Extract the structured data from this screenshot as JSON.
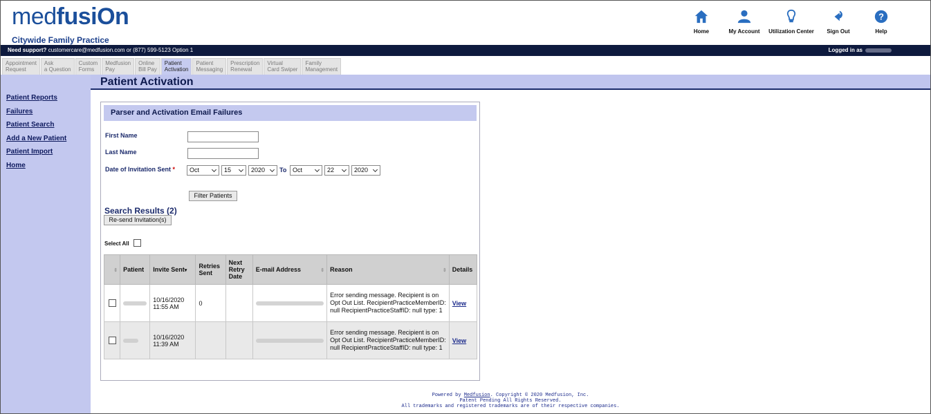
{
  "brand": {
    "logo_light": "med",
    "logo_bold": "fusiOn",
    "practice": "Citywide Family Practice"
  },
  "topnav": [
    {
      "label": "Home",
      "icon": "home-icon"
    },
    {
      "label": "My Account",
      "icon": "user-icon"
    },
    {
      "label": "Utilization Center",
      "icon": "bulb-icon"
    },
    {
      "label": "Sign Out",
      "icon": "signout-icon"
    },
    {
      "label": "Help",
      "icon": "help-icon"
    }
  ],
  "support": {
    "label": "Need support?",
    "text": "customercare@medfusion.com or (877) 599-5123 Option 1",
    "logged_in": "Logged in as"
  },
  "tabs": [
    [
      "Appointment",
      "Request"
    ],
    [
      "Ask",
      "a Question"
    ],
    [
      "Custom",
      "Forms"
    ],
    [
      "Medfusion",
      "Pay"
    ],
    [
      "Online",
      "Bill Pay"
    ],
    [
      "Patient",
      "Activation"
    ],
    [
      "Patient",
      "Messaging"
    ],
    [
      "Prescription",
      "Renewal"
    ],
    [
      "Virtual",
      "Card Swiper"
    ],
    [
      "Family",
      "Management"
    ]
  ],
  "page_title": "Patient Activation",
  "sidebar": [
    "Patient Reports",
    "Failures",
    "Patient Search",
    "Add a New Patient",
    "Patient Import",
    "Home"
  ],
  "panel": {
    "title": "Parser and Activation Email Failures",
    "first_name_label": "First Name",
    "last_name_label": "Last Name",
    "date_label": "Date of Invitation Sent",
    "required_mark": "*",
    "to_label": "To",
    "from_month": "Oct",
    "from_day": "15",
    "from_year": "2020",
    "to_month": "Oct",
    "to_day": "22",
    "to_year": "2020",
    "filter_button": "Filter Patients",
    "results_title": "Search Results (2)",
    "resend_button": "Re-send Invitation(s)",
    "select_all": "Select All"
  },
  "table": {
    "headers": [
      "Patient",
      "Invite Sent",
      "Retries Sent",
      "Next Retry Date",
      "E-mail Address",
      "Reason",
      "Details"
    ],
    "rows": [
      {
        "sent_date": "10/16/2020",
        "sent_time": "11:55 AM",
        "retries": "0",
        "reason": "Error sending message. Recipient is on Opt Out List. RecipientPracticeMemberID: null RecipientPracticeStaffID: null type: 1",
        "details": "View"
      },
      {
        "sent_date": "10/16/2020",
        "sent_time": "11:39 AM",
        "retries": "",
        "reason": "Error sending message. Recipient is on Opt Out List. RecipientPracticeMemberID: null RecipientPracticeStaffID: null type: 1",
        "details": "View"
      }
    ]
  },
  "footer": {
    "powered": "Powered by",
    "link": "Medfusion",
    "copyright": ". Copyright © 2020 Medfusion, Inc.",
    "line2": "Patent Pending All Rights Reserved.",
    "line3": "All trademarks and registered trademarks are of their respective companies."
  }
}
